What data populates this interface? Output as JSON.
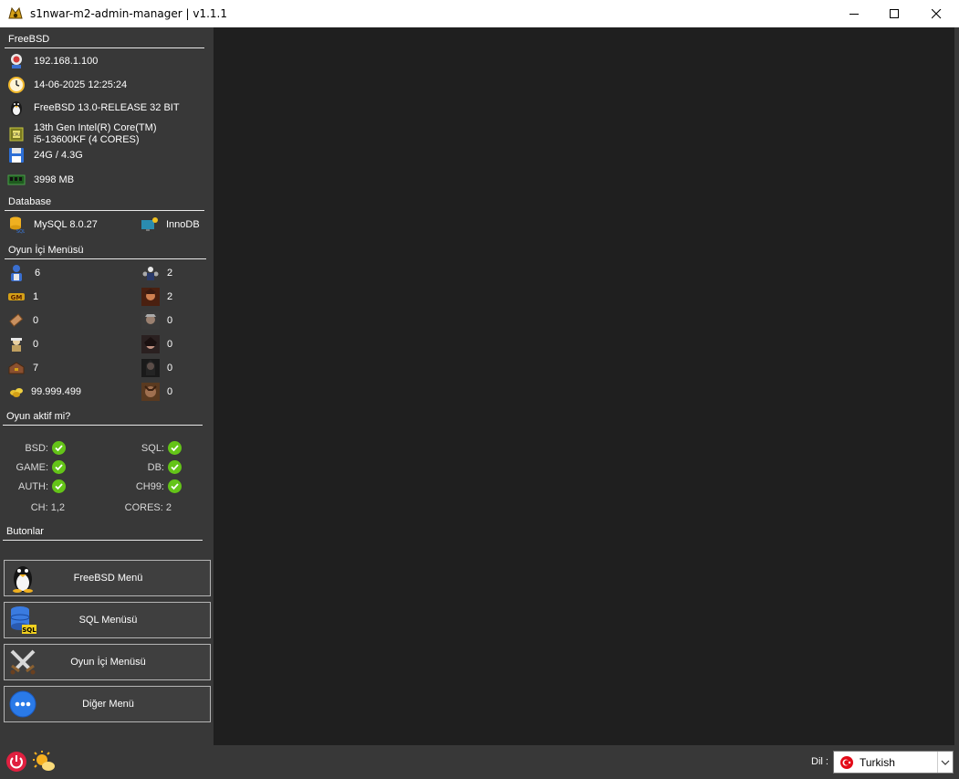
{
  "window": {
    "title": "s1nwar-m2-admin-manager | v1.1.1"
  },
  "freebsd": {
    "section_title": "FreeBSD",
    "ip": "192.168.1.100",
    "datetime": "14-06-2025 12:25:24",
    "os": "FreeBSD 13.0-RELEASE 32 BIT",
    "cpu_line1": "13th Gen Intel(R) Core(TM)",
    "cpu_line2": "i5-13600KF (4 CORES)",
    "disk": "24G / 4.3G",
    "ram": "3998 MB"
  },
  "database": {
    "section_title": "Database",
    "version": "MySQL 8.0.27",
    "engine": "InnoDB"
  },
  "ingame": {
    "section_title": "Oyun İçi Menüsü",
    "left": [
      "6",
      "1",
      "0",
      "0",
      "7",
      "99.999.499"
    ],
    "right": [
      "2",
      "2",
      "0",
      "0",
      "0",
      "0"
    ]
  },
  "status": {
    "section_title": "Oyun aktif mi?",
    "bsd": "BSD:",
    "sql": "SQL:",
    "game": "GAME:",
    "db": "DB:",
    "auth": "AUTH:",
    "ch99": "CH99:",
    "ch": "CH: 1,2",
    "cores": "CORES: 2"
  },
  "buttons": {
    "section_title": "Butonlar",
    "freebsd": "FreeBSD Menü",
    "sql": "SQL Menüsü",
    "ingame": "Oyun İçi Menüsü",
    "other": "Diğer Menü"
  },
  "footer": {
    "lang_label": "Dil :",
    "lang_value": "Turkish"
  },
  "colors": {
    "accent_ok": "#64c418",
    "sidebar_bg": "#383838",
    "main_bg": "#1f1f1f"
  }
}
